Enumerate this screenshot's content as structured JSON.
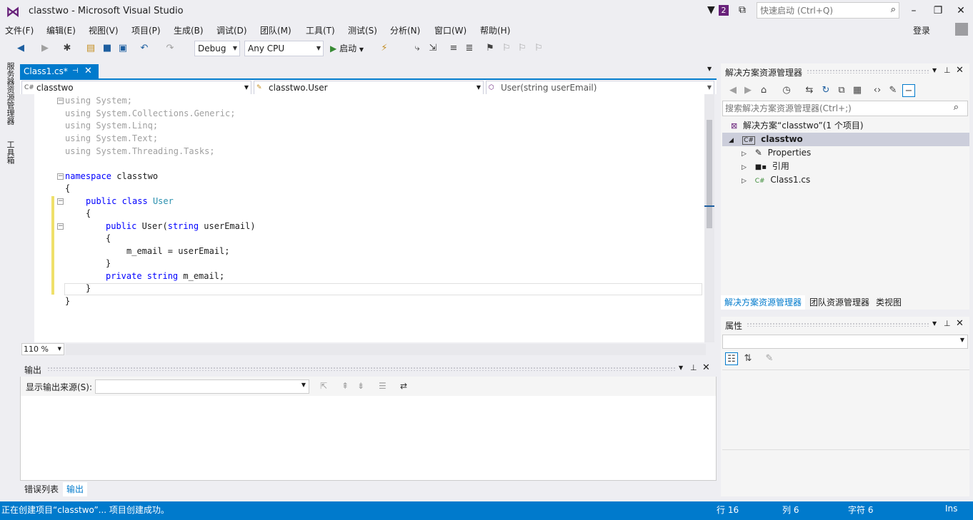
{
  "window": {
    "title": "classtwo - Microsoft Visual Studio",
    "notification_count": "2",
    "quick_launch_placeholder": "快速启动 (Ctrl+Q)",
    "login": "登录"
  },
  "menu": [
    "文件(F)",
    "编辑(E)",
    "视图(V)",
    "项目(P)",
    "生成(B)",
    "调试(D)",
    "团队(M)",
    "工具(T)",
    "测试(S)",
    "分析(N)",
    "窗口(W)",
    "帮助(H)"
  ],
  "toolbar": {
    "config": "Debug",
    "platform": "Any CPU",
    "start": "启动"
  },
  "left_strip": [
    "服务器资源管理器",
    "工具箱"
  ],
  "editor": {
    "tab": "Class1.cs*",
    "nav_project": "classtwo",
    "nav_type": "classtwo.User",
    "nav_member": "User(string userEmail)",
    "zoom": "110 %",
    "code": {
      "l1": "using System;",
      "l2": "using System.Collections.Generic;",
      "l3": "using System.Linq;",
      "l4": "using System.Text;",
      "l5": "using System.Threading.Tasks;",
      "ns_kw": "namespace",
      "ns_name": " classtwo",
      "brace_open": "{",
      "brace_close": "}",
      "cls_kw": "public class",
      "cls_name": "User",
      "ctor_kw": "public",
      "ctor_name": " User(",
      "ctor_ptype": "string",
      "ctor_pname": " userEmail)",
      "assign": "m_email = userEmail;",
      "field_kw": "private string",
      "field_name": " m_email;"
    }
  },
  "output": {
    "title": "输出",
    "source_label": "显示输出来源(S):",
    "tabs": [
      "错误列表",
      "输出"
    ]
  },
  "solution_explorer": {
    "title": "解决方案资源管理器",
    "search_placeholder": "搜索解决方案资源管理器(Ctrl+;)",
    "solution": "解决方案“classtwo”(1 个项目)",
    "project": "classtwo",
    "items": [
      "Properties",
      "引用",
      "Class1.cs"
    ],
    "tabs": [
      "解决方案资源管理器",
      "团队资源管理器",
      "类视图"
    ]
  },
  "properties": {
    "title": "属性"
  },
  "status": {
    "message": "正在创建项目“classtwo”... 项目创建成功。",
    "line": "行 16",
    "col": "列 6",
    "char": "字符 6",
    "mode": "Ins"
  },
  "colors": {
    "accent": "#007acc",
    "brand": "#68217a",
    "keyword": "#0000ff",
    "type": "#2b91af",
    "change_bar": "#efe06a"
  }
}
